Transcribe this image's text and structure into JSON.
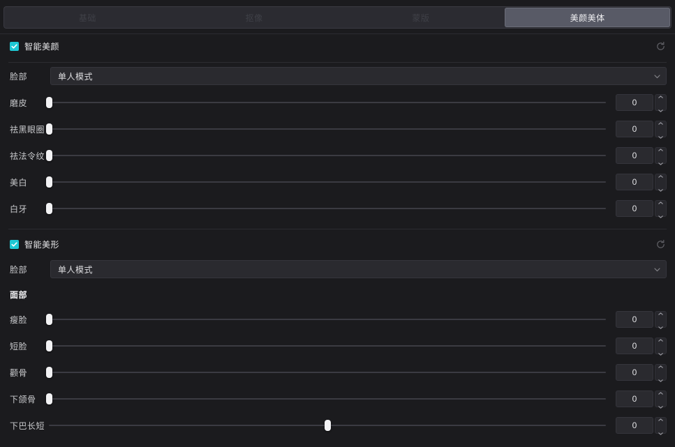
{
  "tabs": [
    {
      "label": "基础",
      "active": false
    },
    {
      "label": "抠像",
      "active": false
    },
    {
      "label": "蒙版",
      "active": false
    },
    {
      "label": "美颜美体",
      "active": true
    }
  ],
  "colors": {
    "accent": "#1ec8d4",
    "panel_bg": "#1b1b1e",
    "tab_active_bg": "#585a66",
    "field_bg": "#2a2a2f",
    "handle": "#f2f2f4"
  },
  "sections": [
    {
      "title": "智能美颜",
      "checked": true,
      "reset_icon": "reset-icon",
      "mode_row": {
        "label": "脸部",
        "value": "单人模式",
        "chevron_icon": "chevron-down-icon"
      },
      "sliders": [
        {
          "label": "磨皮",
          "value": "0",
          "percent": 0
        },
        {
          "label": "祛黑眼圈",
          "value": "0",
          "percent": 0
        },
        {
          "label": "祛法令纹",
          "value": "0",
          "percent": 0
        },
        {
          "label": "美白",
          "value": "0",
          "percent": 0
        },
        {
          "label": "白牙",
          "value": "0",
          "percent": 0
        }
      ]
    },
    {
      "title": "智能美形",
      "checked": true,
      "reset_icon": "reset-icon",
      "mode_row": {
        "label": "脸部",
        "value": "单人模式",
        "chevron_icon": "chevron-down-icon"
      },
      "sub_header": "面部",
      "sliders": [
        {
          "label": "瘦脸",
          "value": "0",
          "percent": 0
        },
        {
          "label": "短脸",
          "value": "0",
          "percent": 0
        },
        {
          "label": "颧骨",
          "value": "0",
          "percent": 0
        },
        {
          "label": "下颌骨",
          "value": "0",
          "percent": 0
        },
        {
          "label": "下巴长短",
          "value": "0",
          "percent": 50
        }
      ]
    }
  ]
}
